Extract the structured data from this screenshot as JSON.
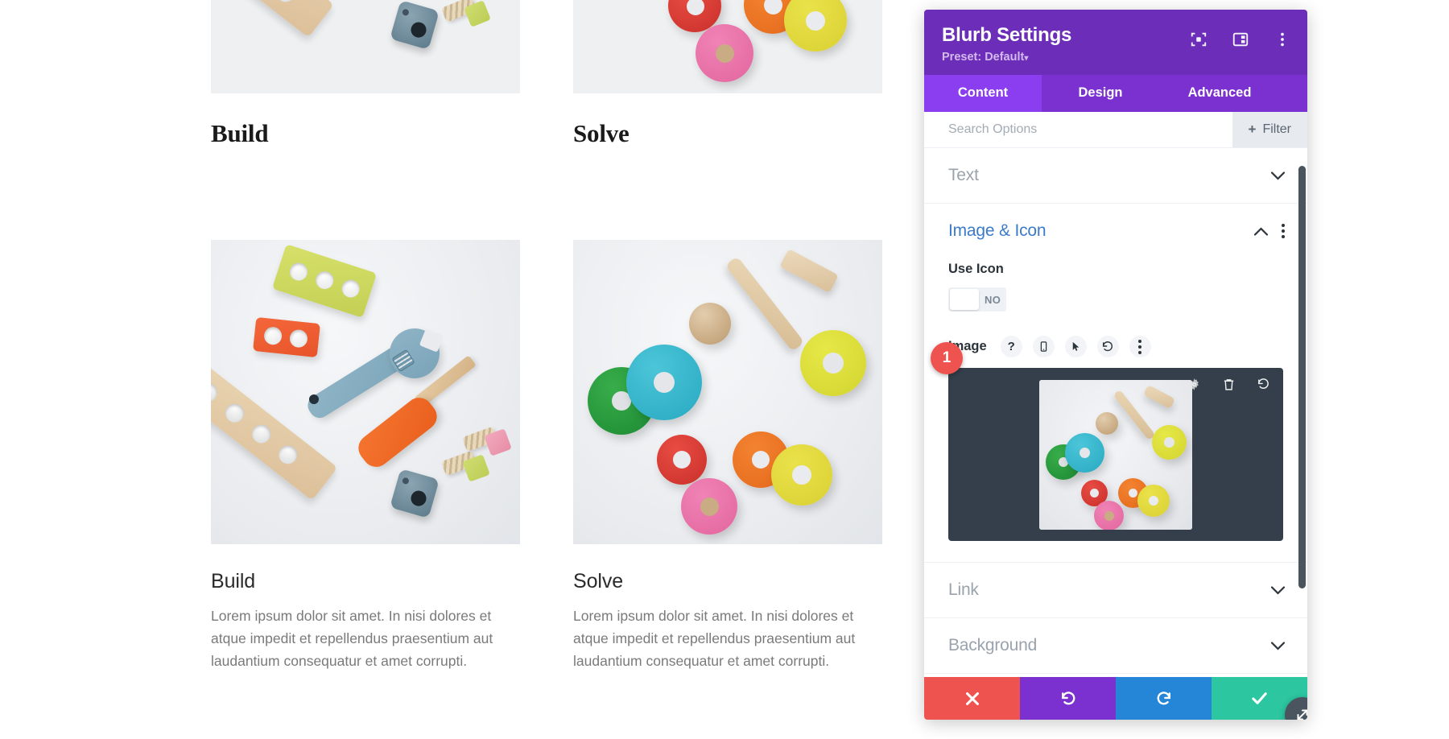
{
  "page": {
    "columns": [
      {
        "top_heading": "Build",
        "heading": "Build",
        "text": "Lorem ipsum dolor sit amet. In nisi dolores et atque impedit et repellendus praesentium aut laudantium consequatur et amet corrupti.",
        "image_alt": "wooden-toy-tools-photo"
      },
      {
        "top_heading": "Solve",
        "heading": "Solve",
        "text": "Lorem ipsum dolor sit amet. In nisi dolores et atque impedit et repellendus praesentium aut laudantium consequatur et amet corrupti.",
        "image_alt": "wooden-stacking-rings-photo"
      }
    ]
  },
  "panel": {
    "title": "Blurb Settings",
    "preset": "Preset: Default",
    "preset_caret": "▾",
    "header_icons": [
      "focus-target-icon",
      "layout-panel-icon",
      "more-vertical-icon"
    ],
    "tabs": [
      {
        "label": "Content",
        "active": true
      },
      {
        "label": "Design",
        "active": false
      },
      {
        "label": "Advanced",
        "active": false
      }
    ],
    "search": {
      "placeholder": "Search Options",
      "value": ""
    },
    "filter_button": {
      "label": "Filter",
      "plus": "+"
    },
    "sections": [
      {
        "label": "Text",
        "state": "collapsed"
      },
      {
        "label": "Image & Icon",
        "state": "expanded"
      },
      {
        "label": "Link",
        "state": "collapsed"
      },
      {
        "label": "Background",
        "state": "collapsed"
      }
    ],
    "image_icon_section": {
      "use_icon": {
        "label": "Use Icon",
        "value": "NO"
      },
      "image": {
        "label": "Image",
        "row_icons": [
          "help-icon",
          "responsive-mobile-icon",
          "hover-cursor-icon",
          "reset-undo-icon",
          "more-vertical-icon"
        ],
        "preview_badge": "1",
        "preview_actions": [
          "settings-gear-icon",
          "trash-icon",
          "reset-undo-icon"
        ]
      }
    },
    "footer_buttons": [
      {
        "name": "cancel",
        "icon": "close-x-icon",
        "color": "#ef5350"
      },
      {
        "name": "undo",
        "icon": "undo-icon",
        "color": "#7b31cf"
      },
      {
        "name": "redo",
        "icon": "redo-icon",
        "color": "#2585d6"
      },
      {
        "name": "save",
        "icon": "check-icon",
        "color": "#2cc6a0"
      }
    ],
    "resize_handle": "resize-diagonal-icon",
    "colors": {
      "header_purple": "#6c2eb9",
      "tab_purple": "#7b31cf",
      "tab_active_purple": "#8b3df0",
      "accent_blue": "#3c7bc9",
      "upload_dark": "#343f4b",
      "badge_red": "#ef5350"
    }
  }
}
